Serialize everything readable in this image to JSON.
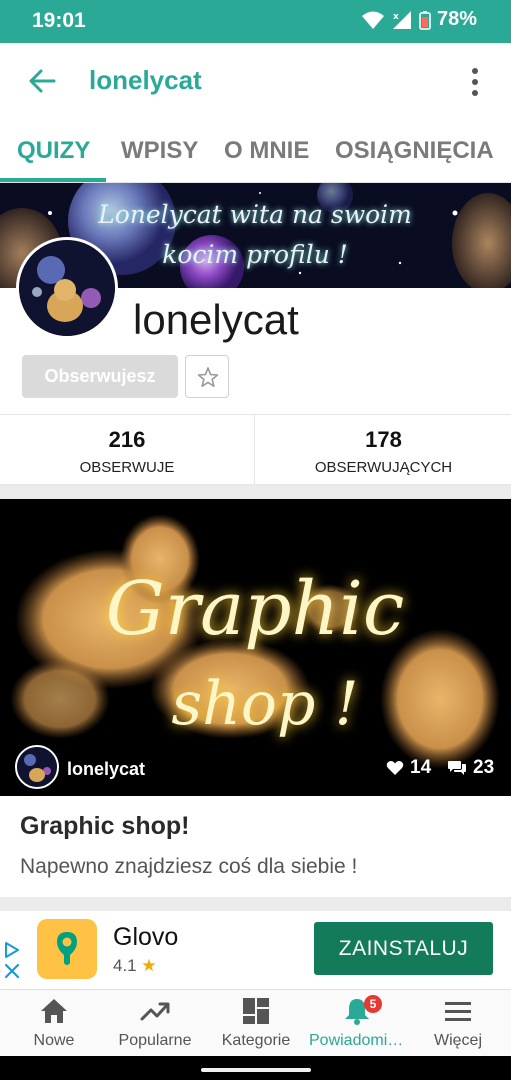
{
  "status_bar": {
    "time": "19:01",
    "battery": "78%"
  },
  "appbar": {
    "title": "lonelycat"
  },
  "tabs": [
    {
      "label": "QUIZY",
      "active": true
    },
    {
      "label": "WPISY",
      "active": false
    },
    {
      "label": "O MNIE",
      "active": false
    },
    {
      "label": "OSIĄGNIĘCIA",
      "active": false
    }
  ],
  "profile": {
    "banner_line1": "Lonelycat wita na swoim",
    "banner_line2": "kocim profilu !",
    "username": "lonelycat",
    "follow_label": "Obserwujesz",
    "stats": [
      {
        "value": "216",
        "label": "OBSERWUJE"
      },
      {
        "value": "178",
        "label": "OBSERWUJĄCYCH"
      }
    ]
  },
  "post": {
    "image_line1": "Graphic",
    "image_line2": "shop !",
    "author": "lonelycat",
    "likes": "14",
    "comments": "23",
    "title": "Graphic shop!",
    "description": "Napewno znajdziesz coś dla siebie !"
  },
  "ad": {
    "name": "Glovo",
    "rating": "4.1",
    "cta": "ZAINSTALUJ"
  },
  "bottom_nav": [
    {
      "label": "Nowe",
      "icon": "home-icon"
    },
    {
      "label": "Popularne",
      "icon": "trending-icon"
    },
    {
      "label": "Kategorie",
      "icon": "categories-icon"
    },
    {
      "label": "Powiadomienia",
      "icon": "bell-icon",
      "active": true,
      "badge": "5"
    },
    {
      "label": "Więcej",
      "icon": "menu-icon"
    }
  ],
  "colors": {
    "accent": "#2aa996",
    "install": "#137a5a",
    "badge": "#e53935"
  }
}
